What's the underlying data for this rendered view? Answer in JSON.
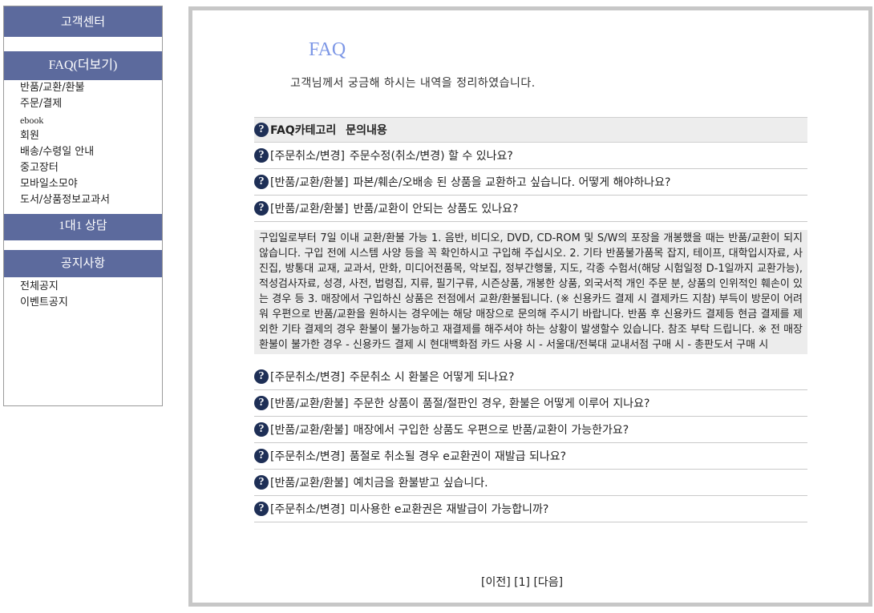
{
  "sidebar": {
    "customer_center": "고객센터",
    "faq_more": "FAQ(더보기)",
    "faq_items": [
      "반품/교환/환불",
      "주문/결제",
      "ebook",
      "회원",
      "배송/수령일 안내",
      "중고장터",
      "모바일소모야",
      "도서/상품정보교과서"
    ],
    "one_on_one": "1대1 상담",
    "notice": "공지사항",
    "notice_items": [
      "전체공지",
      "이벤트공지"
    ]
  },
  "main": {
    "title": "FAQ",
    "subtitle": "고객님께서 궁금해 하시는 내역을 정리하였습니다.",
    "table_header": {
      "category": "FAQ카테고리",
      "question": "문의내용"
    },
    "rows": [
      {
        "category": "[주문취소/변경]",
        "question": "주문수정(취소/변경) 할 수 있나요?"
      },
      {
        "category": "[반품/교환/환불]",
        "question": "파본/훼손/오배송 된 상품을 교환하고 싶습니다. 어떻게 해야하나요?"
      },
      {
        "category": "[반품/교환/환불]",
        "question": "반품/교환이 안되는 상품도 있나요?"
      }
    ],
    "answer": "구입일로부터 7일 이내 교환/환불 가능 1. 음반, 비디오, DVD, CD-ROM 및 S/W의 포장을 개봉했을 때는 반품/교환이 되지 않습니다. 구입 전에 시스템 사양 등을 꼭 확인하시고 구입해 주십시오. 2. 기타 반품불가품목 잡지, 테이프, 대학입시자료, 사진집, 방통대 교재, 교과서, 만화, 미디어전품목, 악보집, 정부간행물, 지도, 각종 수험서(해당 시험일정 D-1일까지 교환가능), 적성검사자료, 성경, 사전, 법령집, 지류, 필기구류, 시즌상품, 개봉한 상품, 외국서적 개인 주문 분, 상품의 인위적인 훼손이 있는 경우 등 3. 매장에서 구입하신 상품은 전점에서 교환/환불됩니다. (※ 신용카드 결제 시 결제카드 지참) 부득이 방문이 어려워 우편으로 반품/교환을 원하시는 경우에는 해당 매장으로 문의해 주시기 바랍니다. 반품 후 신용카드 결제등 현금 결제를 제외한 기타 결제의 경우 환불이 불가능하고 재결제를 해주셔야 하는 상황이 발생할수 있습니다. 참조 부탁 드립니다. ※ 전 매장 환불이 불가한 경우 - 신용카드 결제 시 현대백화점 카드 사용 시 - 서울대/전북대 교내서점 구매 시 - 총판도서 구매 시",
    "rows_after": [
      {
        "category": "[주문취소/변경]",
        "question": "주문취소 시 환불은 어떻게 되나요?"
      },
      {
        "category": "[반품/교환/환불]",
        "question": "주문한 상품이 품절/절판인 경우, 환불은 어떻게 이루어 지나요?"
      },
      {
        "category": "[반품/교환/환불]",
        "question": "매장에서 구입한 상품도 우편으로 반품/교환이 가능한가요?"
      },
      {
        "category": "[주문취소/변경]",
        "question": "품절로 취소될 경우 e교환권이 재발급 되나요?"
      },
      {
        "category": "[반품/교환/환불]",
        "question": "예치금을 환불받고 싶습니다."
      },
      {
        "category": "[주문취소/변경]",
        "question": "미사용한 e교환권은 재발급이 가능합니까?"
      }
    ],
    "pager": {
      "prev": "[이전]",
      "page": "[1]",
      "next": "[다음]"
    }
  }
}
